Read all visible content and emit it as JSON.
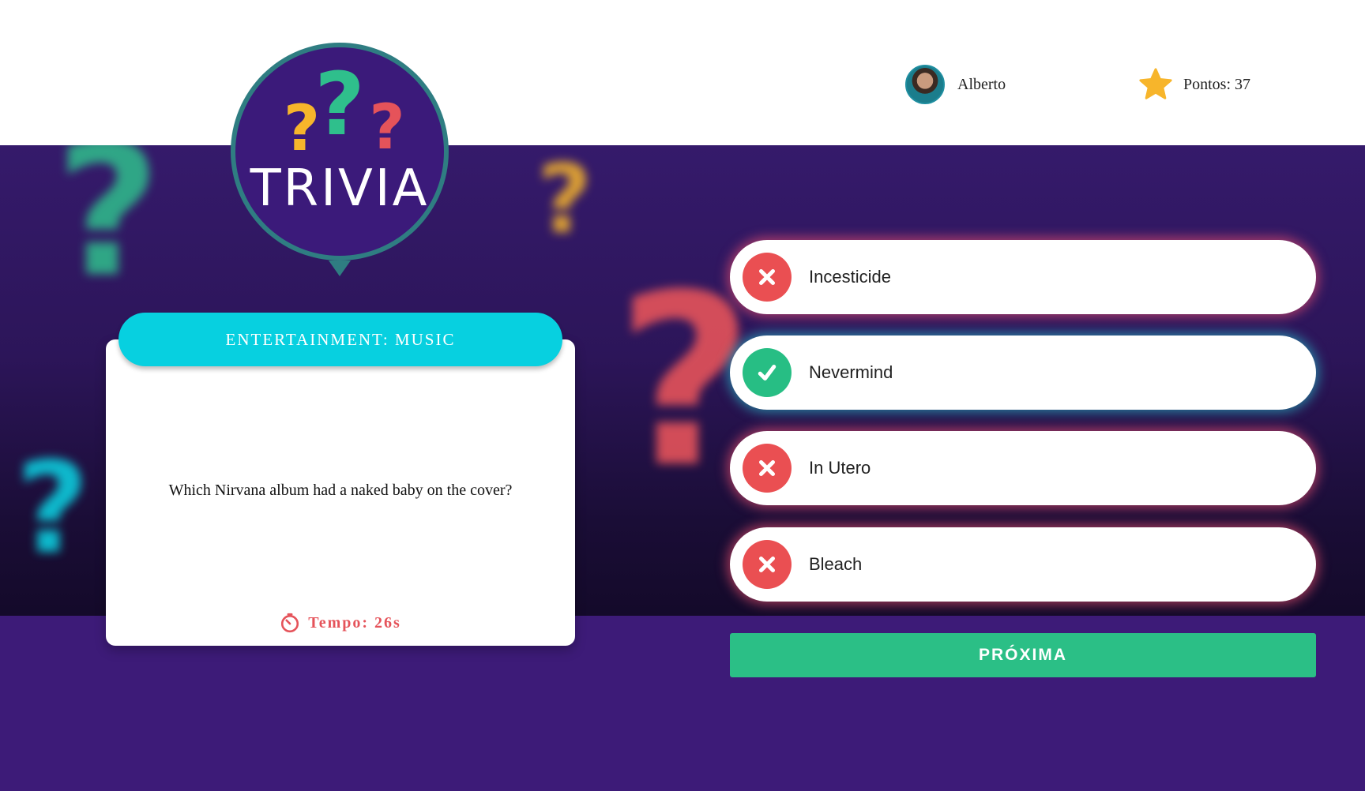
{
  "header": {
    "user_name": "Alberto",
    "score_label": "Pontos: 37"
  },
  "logo": {
    "text": "TRIVIA"
  },
  "question_card": {
    "category": "ENTERTAINMENT: MUSIC",
    "question": "Which Nirvana album had a naked baby on the cover?",
    "timer_label": "Tempo: 26s"
  },
  "answers": [
    {
      "label": "Incesticide",
      "status": "wrong"
    },
    {
      "label": "Nevermind",
      "status": "correct"
    },
    {
      "label": "In Utero",
      "status": "wrong"
    },
    {
      "label": "Bleach",
      "status": "wrong"
    }
  ],
  "next_button": {
    "label": "PRÓXIMA"
  },
  "colors": {
    "background_purple": "#3d1b78",
    "category_cyan": "#07d0e0",
    "correct_green": "#27be84",
    "wrong_red": "#ea4f52",
    "next_green": "#2bbf86",
    "star_yellow": "#f7b52b"
  },
  "icons": {
    "star": "star-icon",
    "timer": "timer-icon",
    "wrong": "x-icon",
    "correct": "check-icon"
  }
}
